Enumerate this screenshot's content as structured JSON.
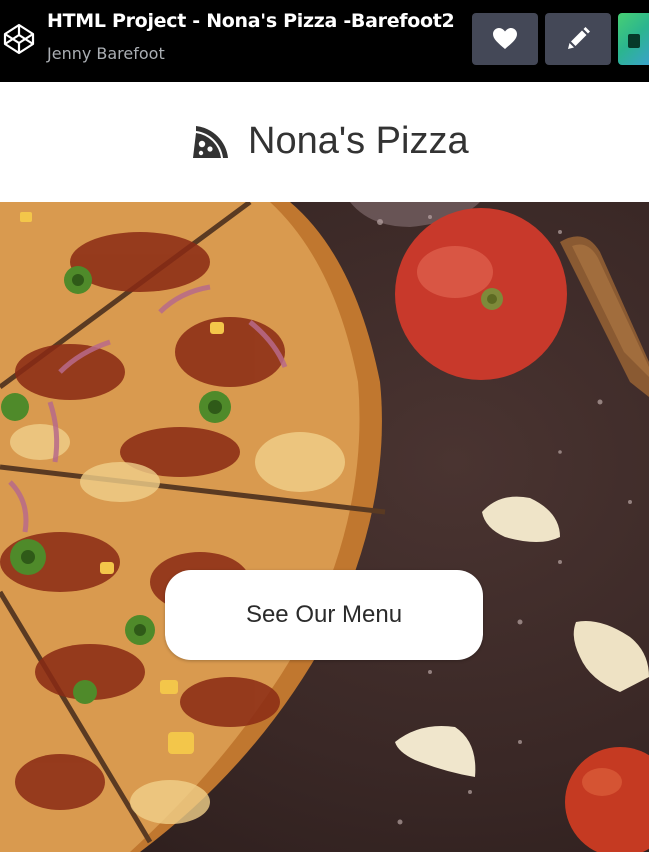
{
  "topbar": {
    "project_title": "HTML Project - Nona's Pizza -Barefoot2",
    "author": "Jenny Barefoot",
    "icons": {
      "logo": "codepen-cube-icon",
      "like": "heart-icon",
      "edit": "pencil-icon"
    }
  },
  "site": {
    "name": "Nona's Pizza",
    "logo_icon": "pizza-slice-icon"
  },
  "hero": {
    "image": "pizza-with-tomatoes-and-garlic-photo",
    "cta_label": "See Our Menu"
  },
  "colors": {
    "topbar_bg": "#000000",
    "icon_button_bg": "#444857",
    "author_text": "#aaaeb3",
    "site_name_text": "#333333",
    "cta_bg": "#ffffff"
  }
}
